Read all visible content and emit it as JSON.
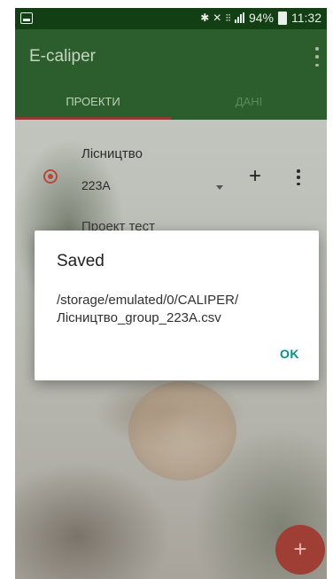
{
  "status_bar": {
    "battery": "94%",
    "time": "11:32"
  },
  "app_bar": {
    "title": "E-caliper",
    "tabs": [
      {
        "label": "ПРОЕКТИ",
        "active": true
      },
      {
        "label": "ДАНІ",
        "active": false
      }
    ]
  },
  "project_row": {
    "group_label": "Лісництво",
    "selected_value": "223A",
    "add_glyph": "+"
  },
  "next_project_peek": "Проект тест",
  "fab": {
    "glyph": "+"
  },
  "dialog": {
    "title": "Saved",
    "message_line1": "/storage/emulated/0/CALIPER/",
    "message_line2": "Лісництво_group_223A.csv",
    "ok_label": "OK"
  },
  "colors": {
    "app_bar": "#2b5e2c",
    "status_bar": "#123f14",
    "accent": "#b9473c",
    "dialog_button": "#0a8f86"
  }
}
